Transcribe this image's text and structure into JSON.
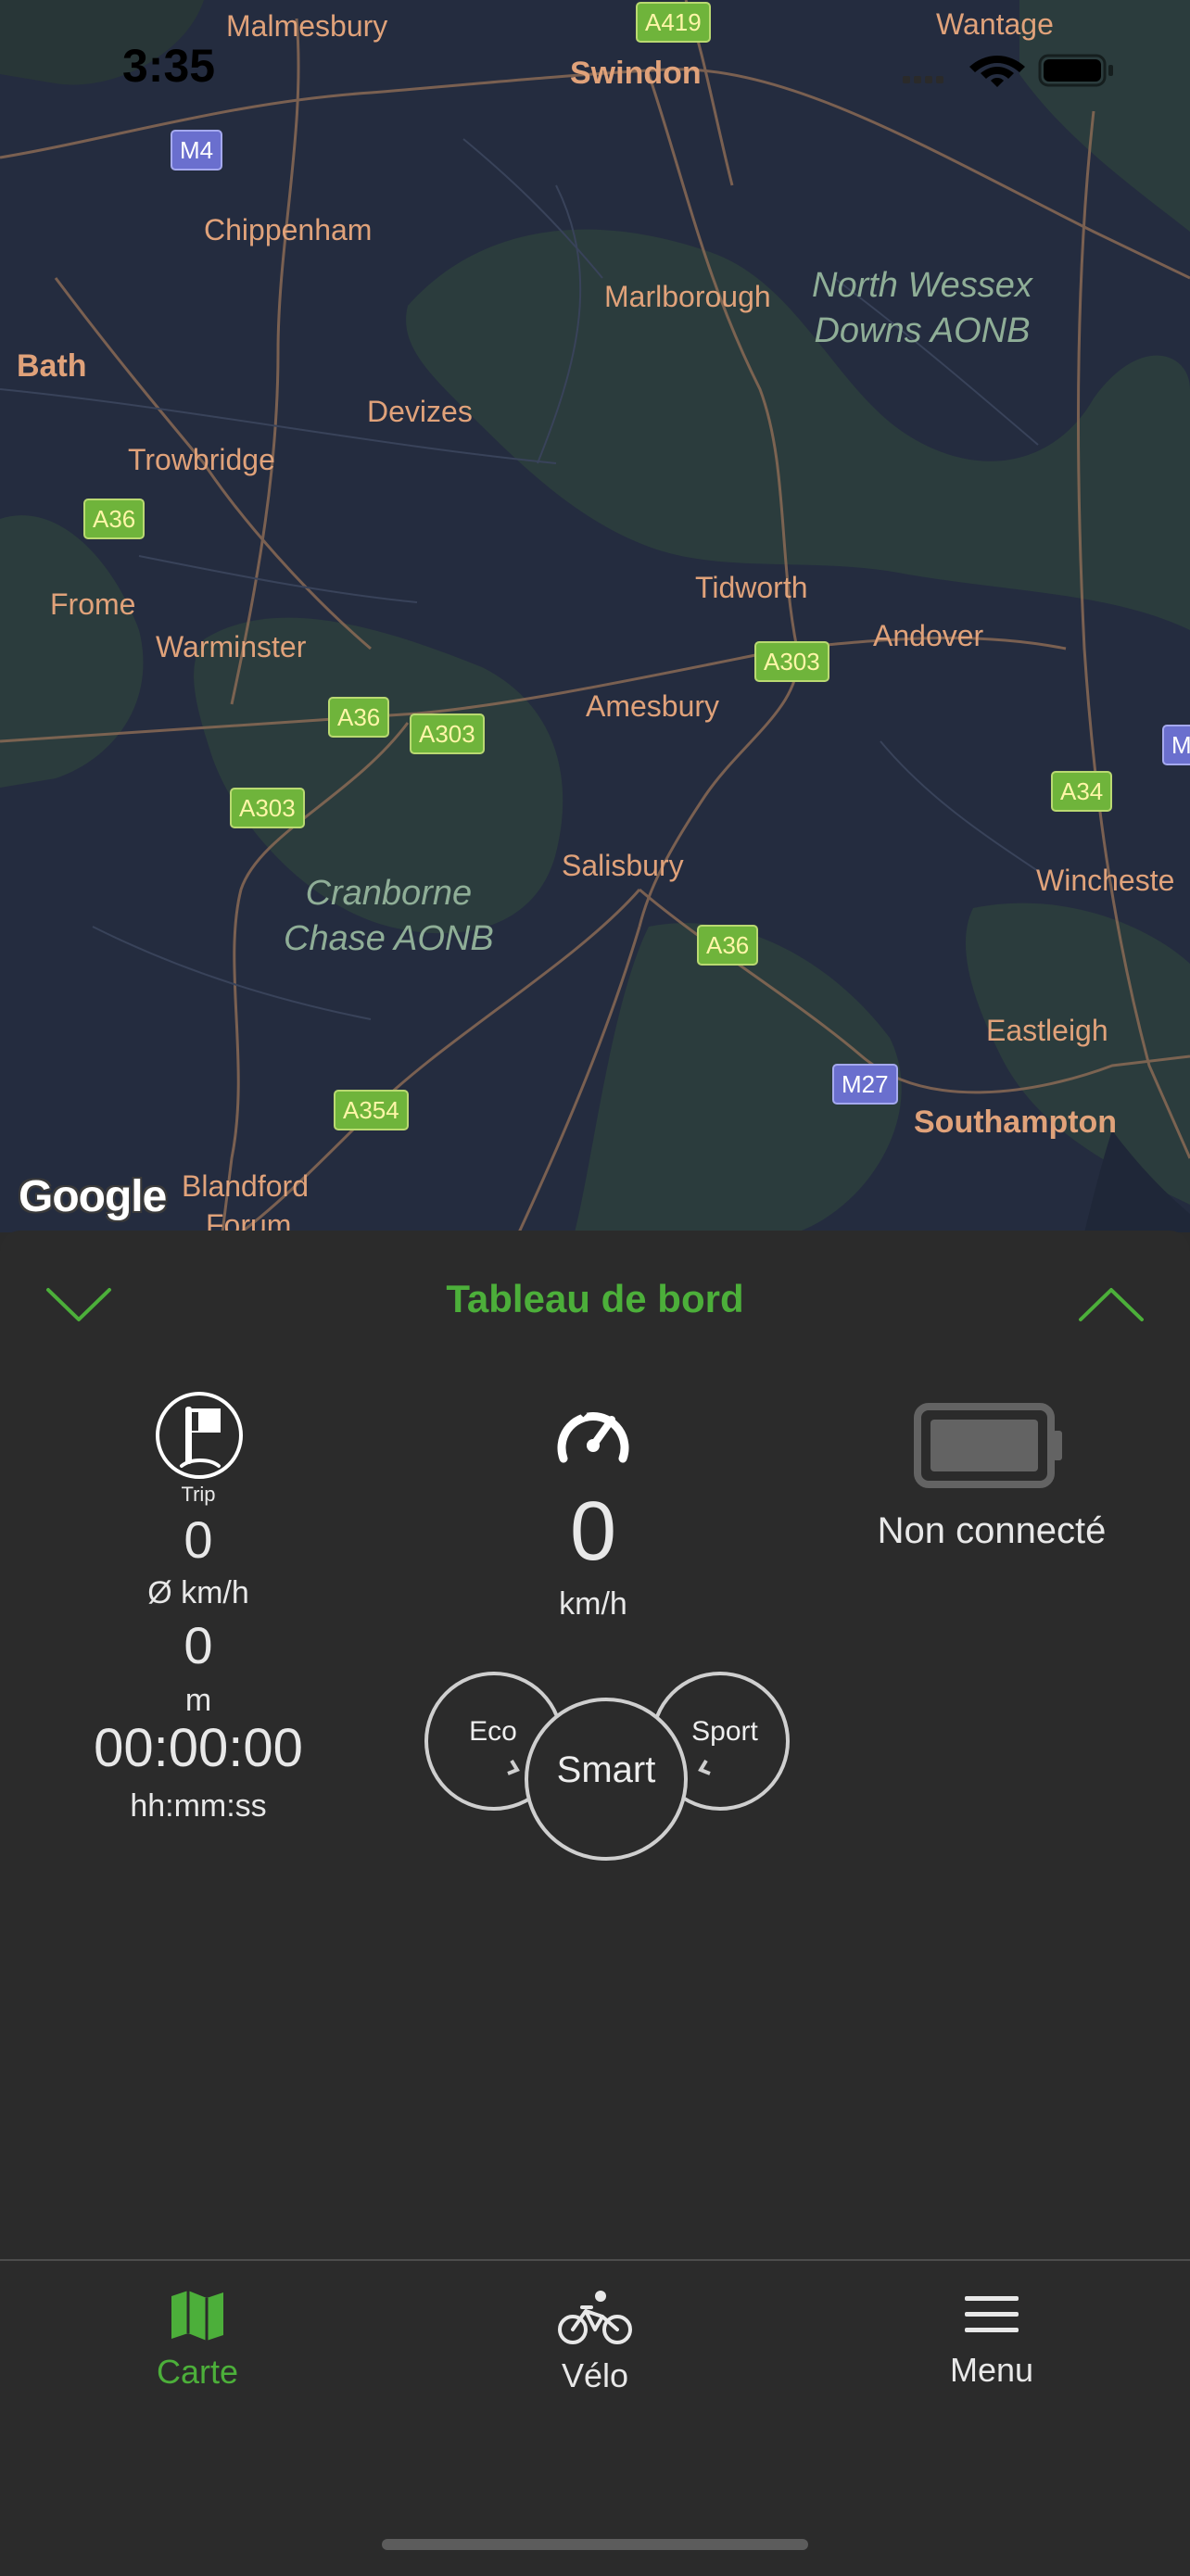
{
  "status_bar": {
    "time": "3:35"
  },
  "map": {
    "places": {
      "malmesbury": "Malmesbury",
      "swindon": "Swindon",
      "wantage": "Wantage",
      "chippenham": "Chippenham",
      "marlborough": "Marlborough",
      "bath": "Bath",
      "devizes": "Devizes",
      "trowbridge": "Trowbridge",
      "frome": "Frome",
      "warminster": "Warminster",
      "tidworth": "Tidworth",
      "andover": "Andover",
      "amesbury": "Amesbury",
      "salisbury": "Salisbury",
      "winchester": "Wincheste",
      "eastleigh": "Eastleigh",
      "southampton": "Southampton",
      "blandford": "Blandford",
      "forum": "Forum"
    },
    "areas": {
      "north_wessex": "North Wessex\nDowns AONB",
      "cranborne": "Cranborne\nChase AONB"
    },
    "shields": {
      "a419": "A419",
      "m4": "M4",
      "a36_1": "A36",
      "a36_2": "A36",
      "a303_1": "A303",
      "a303_2": "A303",
      "a303_3": "A303",
      "a36_3": "A36",
      "a34": "A34",
      "m_edge": "M",
      "a354": "A354",
      "m27": "M27"
    },
    "attribution": "Google"
  },
  "dashboard": {
    "title": "Tableau de bord",
    "trip": {
      "icon_label": "Trip",
      "avg_speed": "0",
      "avg_speed_unit": "Ø km/h",
      "distance": "0",
      "distance_unit": "m",
      "duration": "00:00:00",
      "duration_unit": "hh:mm:ss"
    },
    "speed": {
      "value": "0",
      "unit": "km/h"
    },
    "battery": {
      "status": "Non connecté"
    },
    "modes": {
      "eco": "Eco",
      "smart": "Smart",
      "sport": "Sport",
      "selected": "Smart"
    }
  },
  "tabbar": {
    "tabs": [
      {
        "label": "Carte",
        "icon": "map-icon",
        "active": true
      },
      {
        "label": "Vélo",
        "icon": "bike-icon",
        "active": false
      },
      {
        "label": "Menu",
        "icon": "hamburger-icon",
        "active": false
      }
    ],
    "active_color": "#4caf3a",
    "inactive_color": "#e8e8e8"
  }
}
